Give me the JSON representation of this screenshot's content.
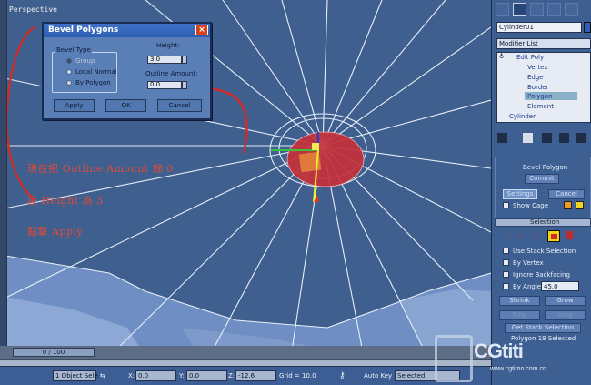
{
  "viewport": {
    "label": "Perspective"
  },
  "dialog": {
    "title": "Bevel Polygons",
    "close": "×",
    "bevel_type_label": "Bevel Type",
    "options": [
      "Group",
      "Local Normal",
      "By Polygon"
    ],
    "height_label": "Height:",
    "height_value": "3.0",
    "outline_label": "Outline Amount:",
    "outline_value": "0.0",
    "buttons": [
      "Apply",
      "OK",
      "Cancel"
    ]
  },
  "annotations": [
    "現在把 Outline Amount 歸 0",
    "設 Height 為 3",
    "點擊 Apply"
  ],
  "timeline": {
    "frame": "0 / 100"
  },
  "status": {
    "selection": "1 Object Sele",
    "x_label": "X:",
    "x_value": "0.0",
    "y_label": "Y:",
    "y_value": "0.0",
    "z_label": "Z:",
    "z_value": "-12.6",
    "grid": "Grid = 10.0",
    "autokey": "Auto Key",
    "selected": "Selected"
  },
  "command_panel": {
    "object_name": "Cylinder01",
    "modifier_list": "Modifier List",
    "stack": [
      "Edit Poly",
      "Vertex",
      "Edge",
      "Border",
      "Polygon",
      "Element",
      "Cylinder"
    ],
    "bevel_caption": "Bevel Polygon",
    "commit": "Commit",
    "settings": "Settings",
    "cancel": "Cancel",
    "show_cage": "Show Cage",
    "selection_title": "Selection",
    "use_stack": "Use Stack Selection",
    "by_vertex": "By Vertex",
    "ignore_backfacing": "Ignore Backfacing",
    "by_angle": "By Angle:",
    "angle_value": "45.0",
    "shrink": "Shrink",
    "grow": "Grow",
    "ring": "Ring",
    "loop": "Loop",
    "get_stack": "Get Stack Selection",
    "polygon_selected": "Polygon 19 Selected"
  },
  "watermark": {
    "brand": "CGtiti",
    "url": "www.cgtimo.com.cn"
  },
  "colors": {
    "accent_red": "#e04a3a",
    "viewport": "#3f5f8e",
    "selected_poly": "#c4303a"
  }
}
